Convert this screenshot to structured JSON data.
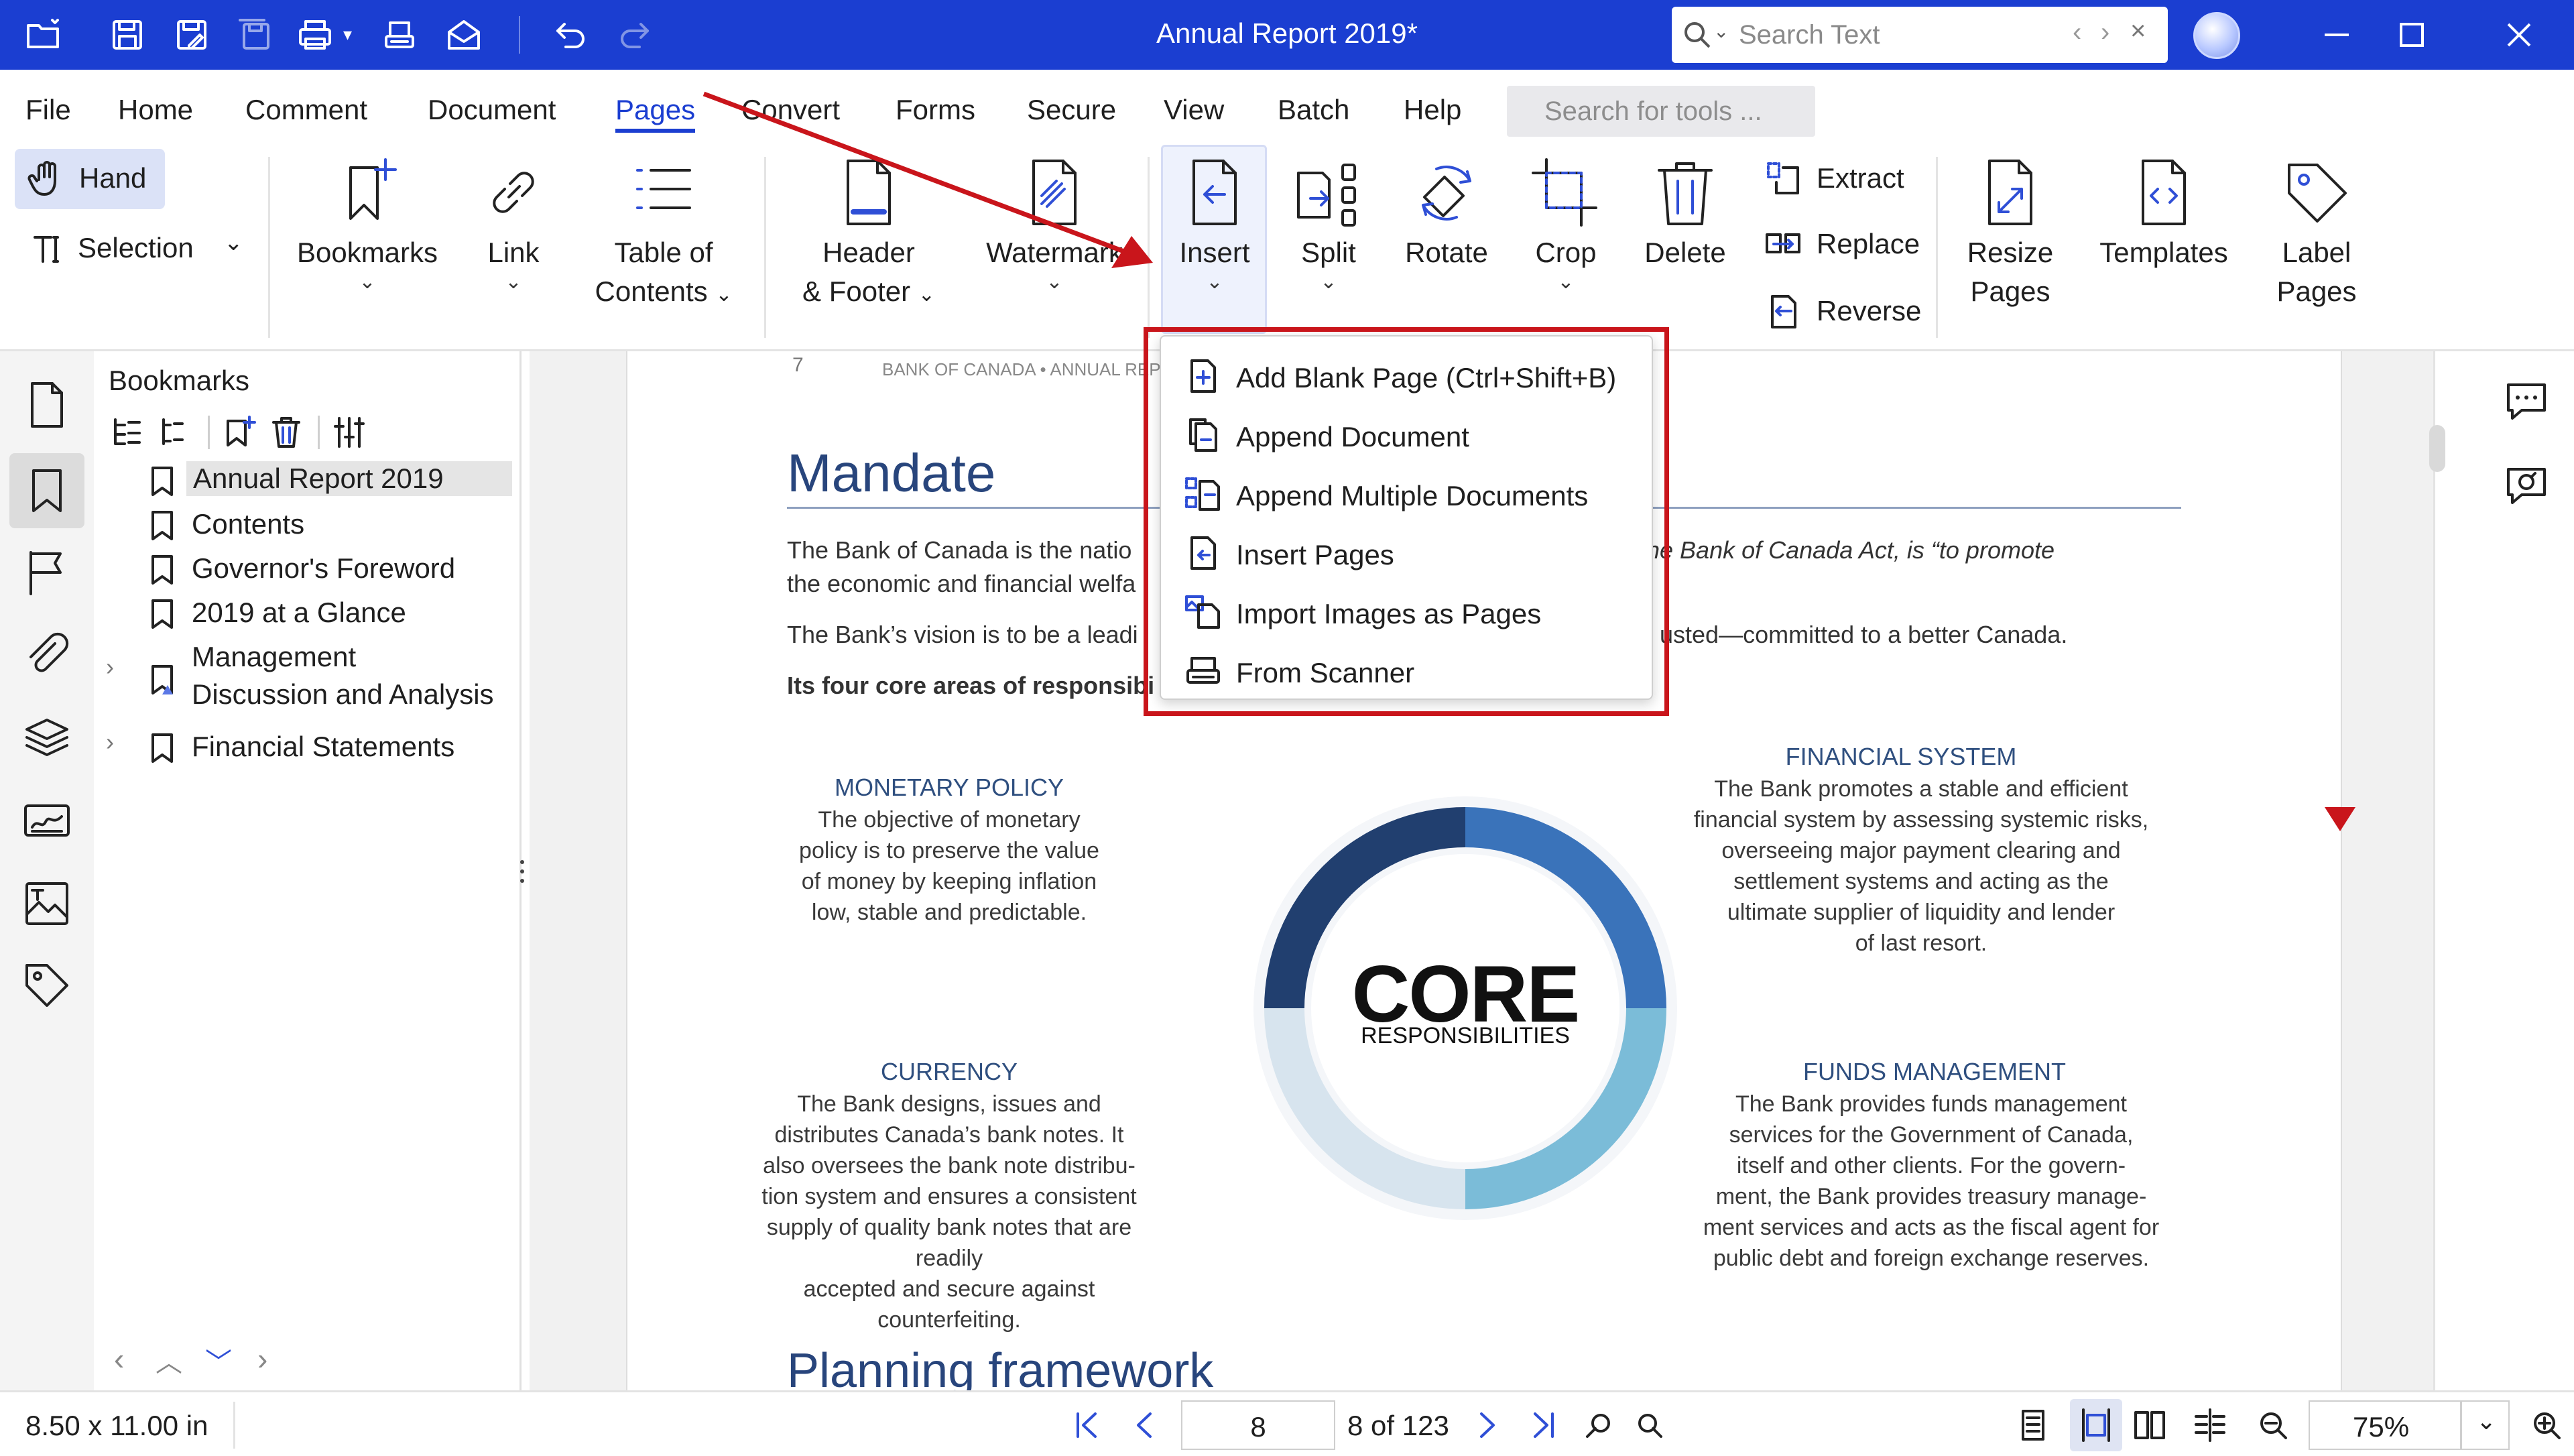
{
  "app": {
    "title": "Annual Report 2019*"
  },
  "titlebar": {
    "search_placeholder": "Search Text"
  },
  "menu": {
    "items": [
      "File",
      "Home",
      "Comment",
      "Document",
      "Pages",
      "Convert",
      "Forms",
      "Secure",
      "View",
      "Batch",
      "Help"
    ],
    "active": "Pages",
    "tool_search_placeholder": "Search for tools ..."
  },
  "ribbon": {
    "hand": "Hand",
    "selection": "Selection",
    "bookmarks": "Bookmarks",
    "link": "Link",
    "toc_line1": "Table of",
    "toc_line2": "Contents",
    "header_line1": "Header",
    "header_line2": "& Footer",
    "watermark": "Watermark",
    "insert": "Insert",
    "split": "Split",
    "rotate": "Rotate",
    "crop": "Crop",
    "delete": "Delete",
    "extract": "Extract",
    "replace": "Replace",
    "reverse": "Reverse",
    "resize_line1": "Resize",
    "resize_line2": "Pages",
    "templates": "Templates",
    "label_line1": "Label",
    "label_line2": "Pages"
  },
  "insert_menu": {
    "items": [
      {
        "label": "Add Blank Page  (Ctrl+Shift+B)"
      },
      {
        "label": "Append Document"
      },
      {
        "label": "Append Multiple Documents"
      },
      {
        "label": "Insert Pages"
      },
      {
        "label": "Import Images as Pages"
      },
      {
        "label": "From Scanner"
      }
    ]
  },
  "bookmarks": {
    "title": "Bookmarks",
    "items": [
      {
        "label": "Annual Report 2019",
        "selected": true
      },
      {
        "label": "Contents"
      },
      {
        "label": "Governor's Foreword"
      },
      {
        "label": "2019 at a Glance"
      },
      {
        "label_line1": "Management",
        "label_line2": "Discussion and Analysis",
        "expandable": true
      },
      {
        "label": "Financial Statements",
        "expandable": true
      }
    ]
  },
  "document": {
    "running_header": "BANK OF CANADA  •  ANNUAL REPO",
    "page_num": "7",
    "heading": "Mandate",
    "para1_a": "The Bank of Canada is the natio",
    "para1_b": "he Bank of Canada Act, is “to promote",
    "para1_line2": "the economic and financial welfa",
    "para2_a": "The Bank’s vision is to be a leadi",
    "para2_b": "usted—committed to a better Canada.",
    "para3": "Its four core areas of responsibi",
    "core_title": "CORE",
    "core_sub": "RESPONSIBILITIES",
    "monetary_title": "MONETARY POLICY",
    "monetary_body": [
      "The objective of monetary",
      "policy is to preserve the value",
      "of money by keeping inflation",
      "low, stable and predictable."
    ],
    "financial_title": "FINANCIAL SYSTEM",
    "financial_body": [
      "The Bank promotes a stable and efficient",
      "financial system by assessing systemic risks,",
      "overseeing major payment clearing and",
      "settlement systems and acting as the",
      "ultimate supplier of liquidity and lender",
      "of  last resort."
    ],
    "currency_title": "CURRENCY",
    "currency_body": [
      "The Bank designs, issues and",
      "distributes Canada’s bank notes. It",
      "also oversees the bank note distribu-",
      "tion system and ensures a consistent",
      "supply of quality bank notes that are readily",
      "accepted and secure against counterfeiting."
    ],
    "funds_title": "FUNDS MANAGEMENT",
    "funds_body": [
      "The Bank provides funds management",
      "services for the Government of Canada,",
      "itself and other clients. For the govern-",
      "ment, the Bank provides treasury manage-",
      "ment services and acts as the fiscal agent for",
      "public debt and foreign exchange reserves."
    ],
    "next_heading": "Planning framework"
  },
  "status": {
    "page_size": "8.50 x 11.00 in",
    "page_input": "8",
    "page_of": "8 of 123",
    "zoom": "75%"
  },
  "colors": {
    "accent": "#1b3ed1",
    "highlight_box": "#c9151b"
  }
}
